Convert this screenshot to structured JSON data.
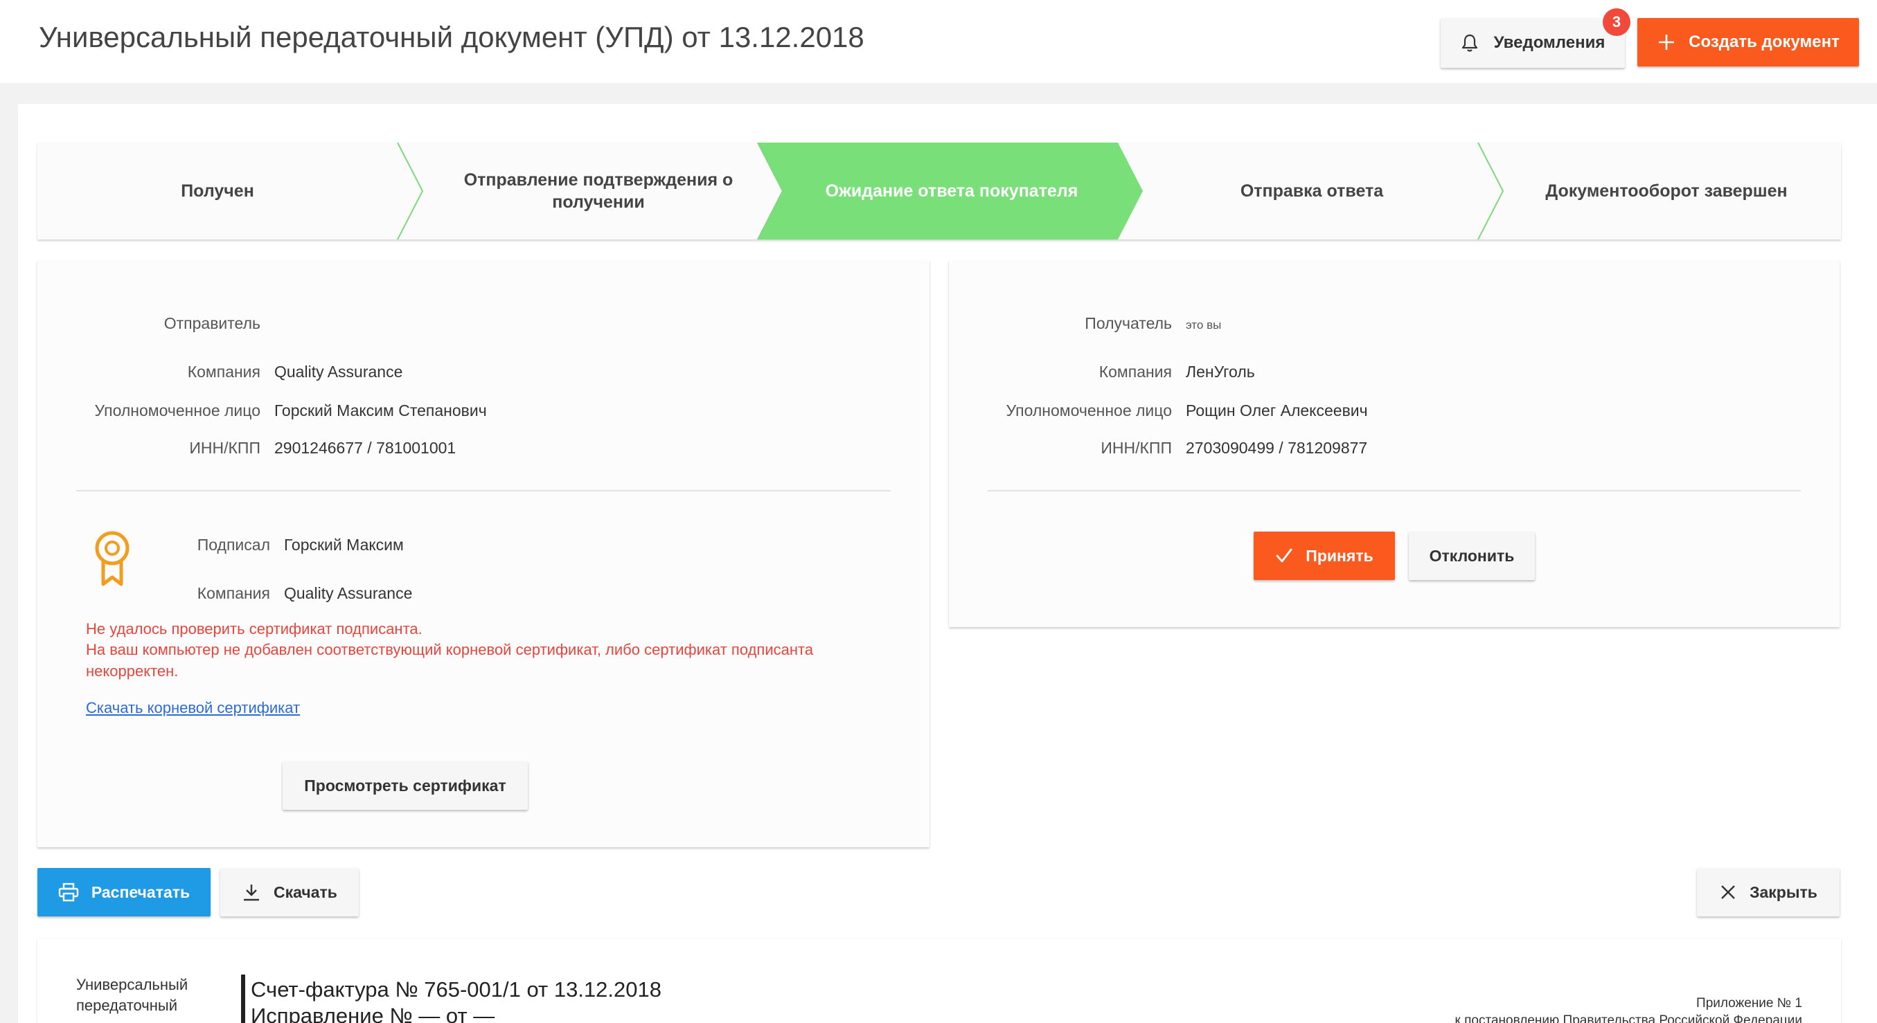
{
  "header": {
    "title": "Универсальный передаточный документ (УПД) от 13.12.2018",
    "notifications_label": "Уведомления",
    "notifications_count": "3",
    "create_label": "Создать документ"
  },
  "stepper": {
    "steps": [
      {
        "label": "Получен",
        "active": false
      },
      {
        "label": "Отправление подтверждения о получении",
        "active": false
      },
      {
        "label": "Ожидание ответа покупателя",
        "active": true
      },
      {
        "label": "Отправка ответа",
        "active": false
      },
      {
        "label": "Документооборот завершен",
        "active": false
      }
    ]
  },
  "sender": {
    "heading": "Отправитель",
    "company_label": "Компания",
    "company": "Quality Assurance",
    "person_label": "Уполномоченное лицо",
    "person": "Горский Максим Степанович",
    "inn_label": "ИНН/КПП",
    "inn": "2901246677 / 781001001"
  },
  "signature": {
    "signed_label": "Подписал",
    "signed_by": "Горский Максим",
    "company_label": "Компания",
    "company": "Quality Assurance",
    "error_line1": "Не удалось проверить сертификат подписанта.",
    "error_line2": "На ваш компьютер не добавлен соответствующий корневой сертификат, либо сертификат подписанта некорректен.",
    "download_link": "Скачать корневой сертификат",
    "view_button": "Просмотреть сертификат"
  },
  "recipient": {
    "heading": "Получатель",
    "you_note": "это вы",
    "company_label": "Компания",
    "company": "ЛенУголь",
    "person_label": "Уполномоченное лицо",
    "person": "Рощин Олег Алексеевич",
    "inn_label": "ИНН/КПП",
    "inn": "2703090499 / 781209877",
    "accept_button": "Принять",
    "reject_button": "Отклонить"
  },
  "toolbar": {
    "print_label": "Распечатать",
    "download_label": "Скачать",
    "close_label": "Закрыть"
  },
  "document": {
    "type_line1": "Универсальный",
    "type_line2": "передаточный",
    "title": "Счет-фактура № 765-001/1 от 13.12.2018",
    "correction": "Исправление №  — от —",
    "appendix_line1": "Приложение № 1",
    "appendix_line2": "к постановлению Правительства Российской Федерации"
  },
  "colors": {
    "accent": "#fb5a1e",
    "active_step": "#79df78",
    "print": "#1f9be6",
    "error": "#e8453c",
    "link": "#2a6bd8",
    "cert_icon": "#f39c1e"
  },
  "icons": [
    "bell-icon",
    "plus-icon",
    "certificate-icon",
    "check-icon",
    "printer-icon",
    "download-icon",
    "close-icon"
  ]
}
